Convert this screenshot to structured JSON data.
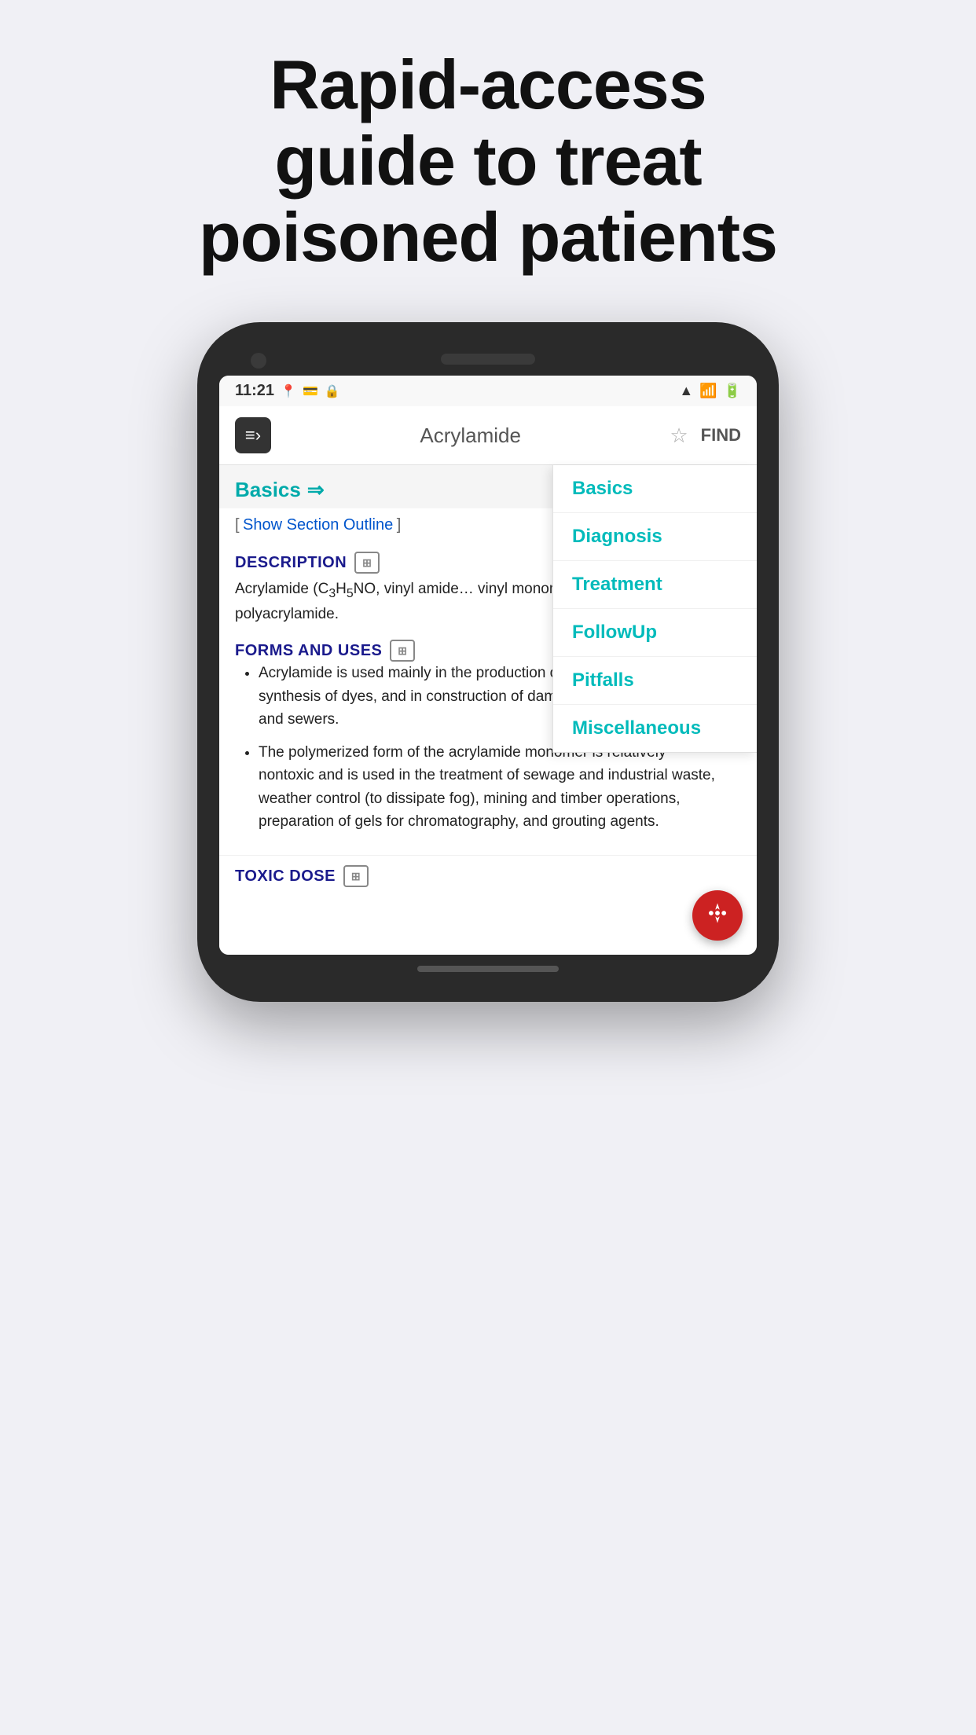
{
  "hero": {
    "line1": "Rapid-access",
    "line2": "guide to treat",
    "line3": "poisoned patients"
  },
  "status_bar": {
    "time": "11:21",
    "icons_left": [
      "location-dot-icon",
      "sim-icon",
      "vpn-icon"
    ],
    "icons_right": [
      "wifi-icon",
      "signal-icon",
      "battery-icon"
    ]
  },
  "app_nav": {
    "logo_icon": "≡›",
    "title": "Acrylamide",
    "star_label": "☆",
    "find_label": "FIND"
  },
  "section_header": {
    "title": "Basics",
    "arrow": "⇒"
  },
  "dropdown": {
    "items": [
      "Basics",
      "Diagnosis",
      "Treatment",
      "FollowUp",
      "Pitfalls",
      "Miscellaneous"
    ]
  },
  "outline": {
    "bracket_open": "[",
    "link_text": "Show Section Outline",
    "bracket_close": "]"
  },
  "description_section": {
    "title": "DESCRIPTION",
    "icon_label": "⊞",
    "body": "Acrylamide (C₃H₅NO, vinyl amide… vinyl monomer that is used to make polyacrylamide."
  },
  "forms_section": {
    "title": "FORMS AND USES",
    "icon_label": "⊞",
    "items": [
      "Acrylamide is used mainly in the production of polyacrylamide, in the synthesis of dyes, and in construction of dam foundations, tunnels, and sewers.",
      "The polymerized form of the acrylamide monomer is relatively nontoxic and is used in the treatment of sewage and industrial waste, weather control (to dissipate fog), mining and timber operations, preparation of gels for chromatography, and grouting agents."
    ]
  },
  "toxic_dose_section": {
    "title": "TOXIC DOSE",
    "icon_label": "⊞"
  },
  "fab": {
    "icon": "⚙"
  }
}
